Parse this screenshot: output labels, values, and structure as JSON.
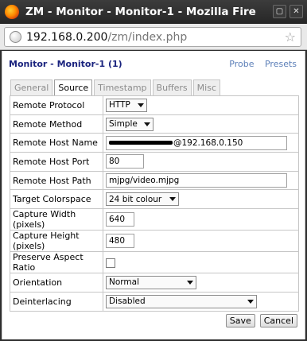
{
  "window": {
    "title": "ZM - Monitor - Monitor-1 - Mozilla Fire",
    "close_glyph": "✕",
    "maximize_glyph": "▢"
  },
  "urlbar": {
    "host": "192.168.0.200",
    "path": "/zm/index.php"
  },
  "page": {
    "title": "Monitor - Monitor-1 (1)",
    "links": [
      "Probe",
      "Presets"
    ]
  },
  "tabs": [
    {
      "label": "General",
      "active": false
    },
    {
      "label": "Source",
      "active": true
    },
    {
      "label": "Timestamp",
      "active": false
    },
    {
      "label": "Buffers",
      "active": false
    },
    {
      "label": "Misc",
      "active": false
    }
  ],
  "form": {
    "remote_protocol": {
      "label": "Remote Protocol",
      "value": "HTTP"
    },
    "remote_method": {
      "label": "Remote Method",
      "value": "Simple"
    },
    "remote_host_name": {
      "label": "Remote Host Name",
      "value": "@192.168.0.150"
    },
    "remote_host_port": {
      "label": "Remote Host Port",
      "value": "80"
    },
    "remote_host_path": {
      "label": "Remote Host Path",
      "value": "mjpg/video.mjpg"
    },
    "target_colorspace": {
      "label": "Target Colorspace",
      "value": "24 bit colour"
    },
    "capture_width": {
      "label": "Capture Width (pixels)",
      "value": "640"
    },
    "capture_height": {
      "label": "Capture Height (pixels)",
      "value": "480"
    },
    "preserve_aspect": {
      "label": "Preserve Aspect Ratio",
      "checked": false
    },
    "orientation": {
      "label": "Orientation",
      "value": "Normal"
    },
    "deinterlacing": {
      "label": "Deinterlacing",
      "value": "Disabled"
    }
  },
  "buttons": {
    "save": "Save",
    "cancel": "Cancel"
  }
}
